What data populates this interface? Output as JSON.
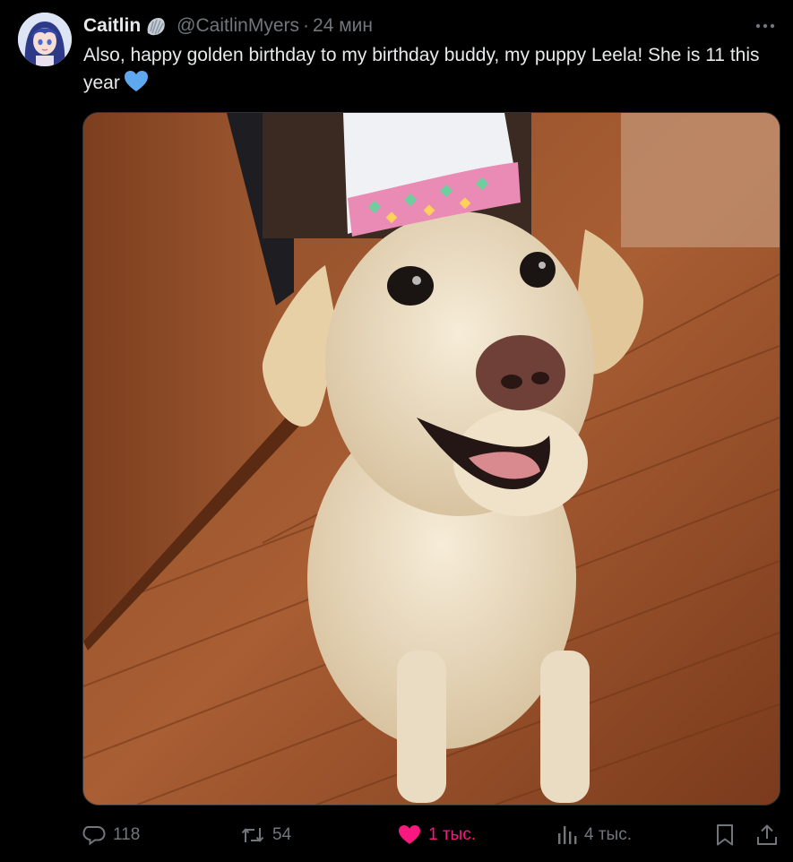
{
  "author": {
    "name": "Caitlin",
    "handle": "@CaitlinMyers",
    "separator": "·",
    "time": "24 мин",
    "badge_icon": "shell-emoji",
    "avatar_icon": "anime-avatar"
  },
  "tweet": {
    "text": "Also, happy golden birthday to my birthday buddy, my puppy Leela! She is 11 this year",
    "emoji": "blue-heart-emoji",
    "media_icon": "dog-party-hat-photo"
  },
  "menu": {
    "more_icon": "more-dots-icon"
  },
  "actions": {
    "reply_count": "118",
    "repost_count": "54",
    "like_count": "1 тыс.",
    "views_count": "4 тыс."
  },
  "colors": {
    "background": "#000000",
    "text": "#e7e9ea",
    "muted": "#71767b",
    "like": "#f91880",
    "heart_emoji": "#5da8ee"
  }
}
